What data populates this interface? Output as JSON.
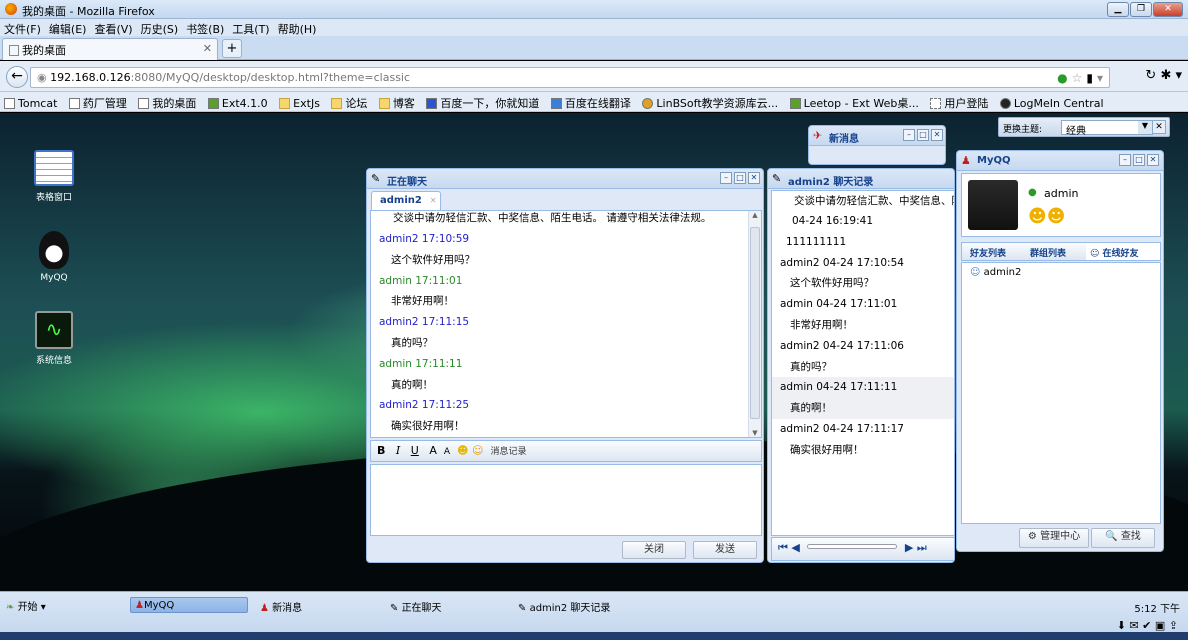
{
  "browser": {
    "window_title": "我的桌面 - Mozilla Firefox",
    "menu": [
      "文件(F)",
      "编辑(E)",
      "查看(V)",
      "历史(S)",
      "书签(B)",
      "工具(T)",
      "帮助(H)"
    ],
    "tab_title": "我的桌面",
    "url_host": "192.168.0.126",
    "url_rest": ":8080/MyQQ/desktop/desktop.html?theme=classic",
    "bookmarks": [
      "Tomcat",
      "药厂管理",
      "我的桌面",
      "Ext4.1.0",
      "ExtJs",
      "论坛",
      "博客",
      "百度一下，你就知道",
      "百度在线翻译",
      "LinBSoft教学资源库云...",
      "Leetop - Ext Web桌...",
      "用户登陆",
      "LogMeIn Central"
    ]
  },
  "desktop": {
    "icons": [
      {
        "label": "表格窗口"
      },
      {
        "label": "MyQQ"
      },
      {
        "label": "系统信息"
      }
    ],
    "theme": {
      "label": "更换主题:",
      "value": "经典"
    }
  },
  "new_message_window": {
    "title": "新消息"
  },
  "chat_window": {
    "title": "正在聊天",
    "tab": "admin2",
    "notice": "交谈中请勿轻信汇款、中奖信息、陌生电话。 请遵守相关法律法规。",
    "messages": [
      {
        "header": "admin2 17:10:59",
        "text": "这个软件好用吗？",
        "from": "other"
      },
      {
        "header": "admin 17:11:01",
        "text": "非常好用啊！",
        "from": "self"
      },
      {
        "header": "admin2 17:11:15",
        "text": "真的吗？",
        "from": "other"
      },
      {
        "header": "admin 17:11:11",
        "text": "真的啊！",
        "from": "self"
      },
      {
        "header": "admin2 17:11:25",
        "text": "确实很好用啊！",
        "from": "other"
      }
    ],
    "toolbar": {
      "bold": "B",
      "italic": "I",
      "underline": "U",
      "grow": "A",
      "shrink": "A",
      "history": "消息记录"
    },
    "close_btn": "关闭",
    "send_btn": "发送"
  },
  "history_window": {
    "title": "admin2 聊天记录",
    "notice": "交谈中请勿轻信汇款、中奖信息、陌",
    "entries": [
      {
        "header": "04-24 16:19:41",
        "text": "111111111"
      },
      {
        "header": "admin2    04-24 17:10:54",
        "text": "这个软件好用吗？"
      },
      {
        "header": "admin    04-24 17:11:01",
        "text": "非常好用啊！"
      },
      {
        "header": "admin2    04-24 17:11:06",
        "text": "真的吗？"
      },
      {
        "header": "admin    04-24 17:11:11",
        "text": "真的啊！"
      },
      {
        "header": "admin2    04-24 17:11:17",
        "text": "确实很好用啊！"
      }
    ]
  },
  "myqq_window": {
    "title": "MyQQ",
    "username": "admin",
    "tabs": [
      "好友列表",
      "群组列表",
      "在线好友"
    ],
    "friends": [
      "admin2"
    ],
    "manage_btn": "管理中心",
    "search_btn": "查找"
  },
  "taskbar": {
    "start": "开始",
    "tasks": [
      "MyQQ",
      "新消息",
      "正在聊天",
      "admin2 聊天记录"
    ],
    "clock": "5:12 下午"
  },
  "colors": {
    "other": "#2222cc",
    "self": "#2a8a2a",
    "header": "#15428b"
  }
}
